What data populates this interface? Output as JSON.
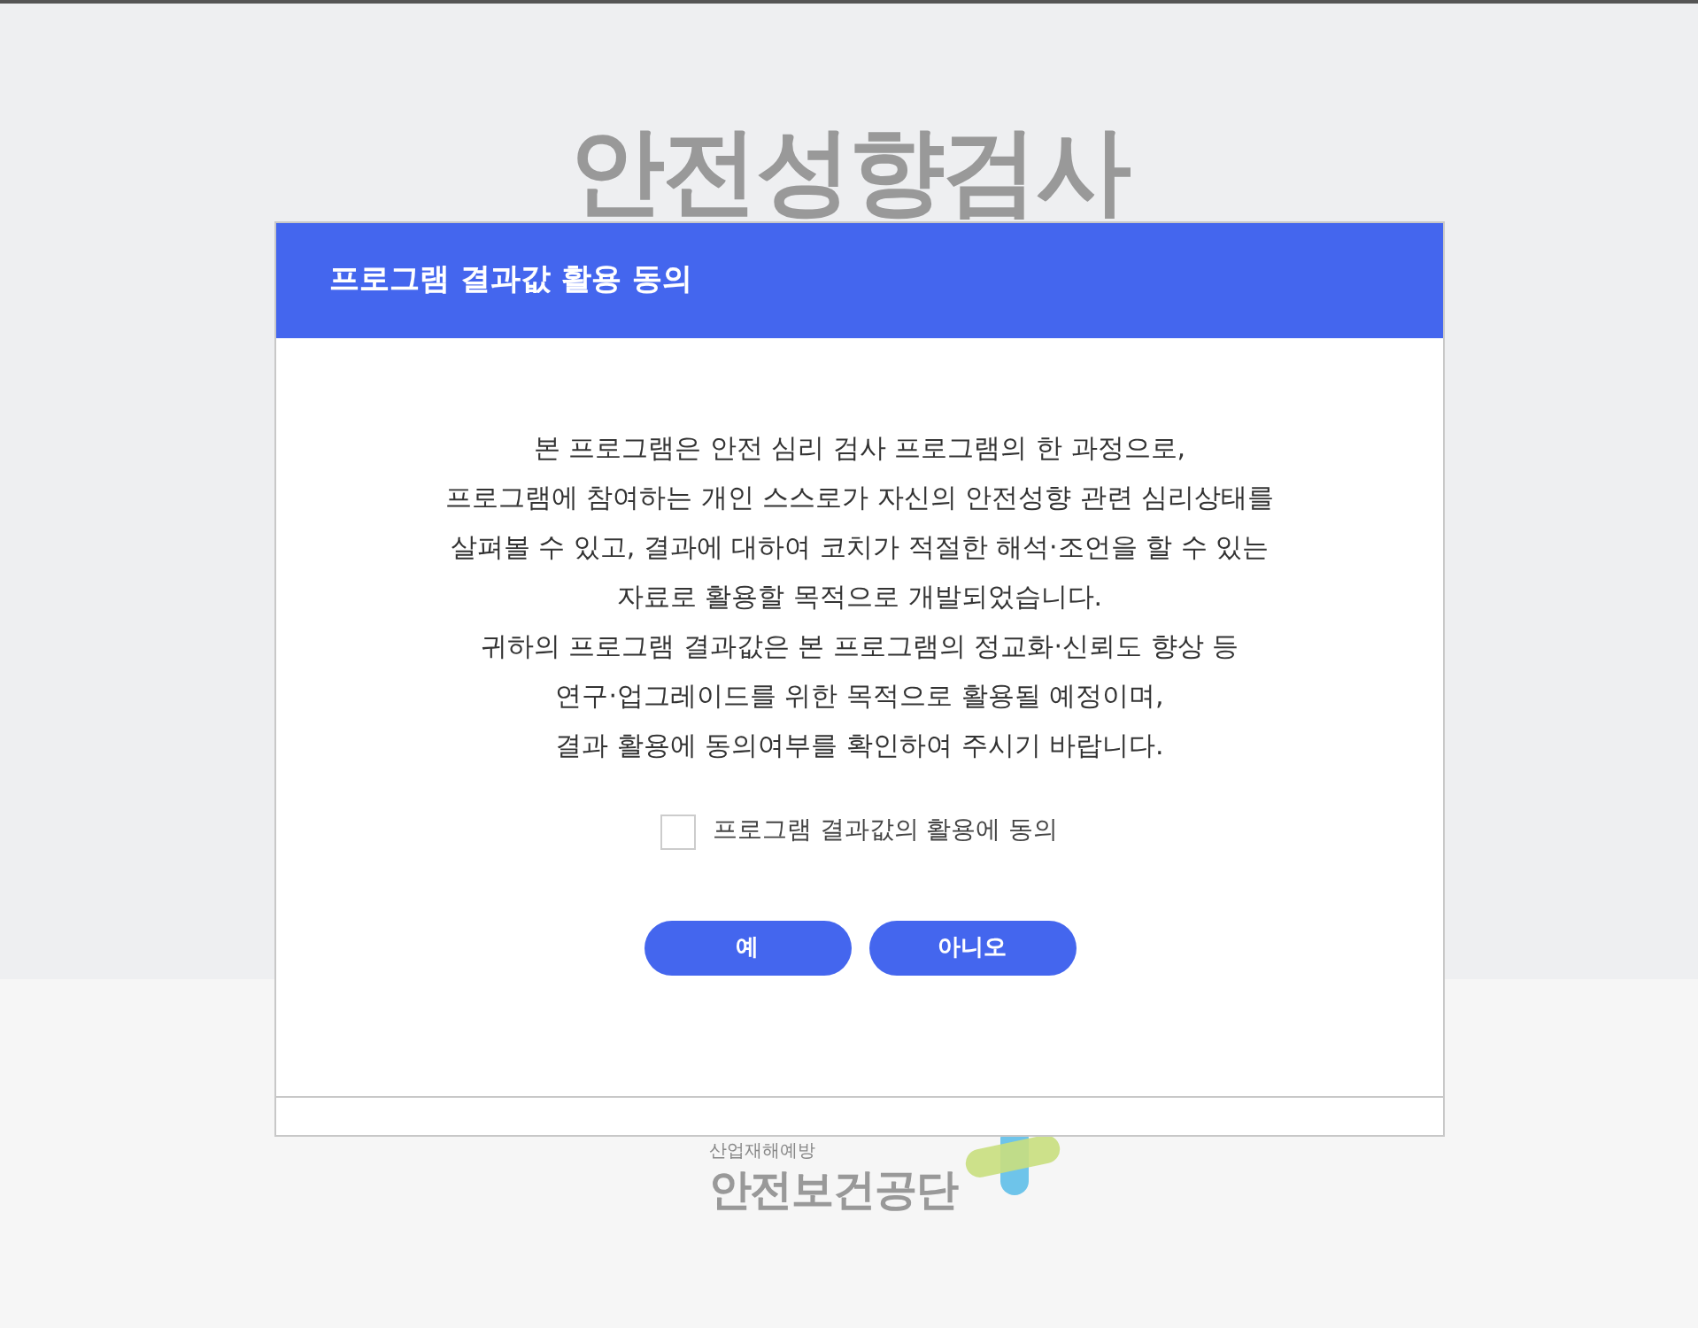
{
  "page_title": "안전성향검사",
  "dialog": {
    "title": "프로그램 결과값 활용 동의",
    "paragraph": [
      "본 프로그램은 안전 심리 검사 프로그램의 한 과정으로,",
      "프로그램에 참여하는 개인 스스로가 자신의 안전성향 관련 심리상태를",
      "살펴볼 수 있고, 결과에 대하여 코치가 적절한 해석·조언을 할 수 있는",
      "자료로 활용할 목적으로 개발되었습니다.",
      "귀하의 프로그램 결과값은 본 프로그램의 정교화·신뢰도 향상 등",
      "연구·업그레이드를 위한 목적으로 활용될 예정이며,",
      "결과 활용에 동의여부를 확인하여 주시기 바랍니다."
    ],
    "consent": {
      "label": "프로그램 결과값의 활용에 동의",
      "checked": false
    },
    "buttons": [
      "예",
      "아니오"
    ]
  },
  "logo": {
    "tagline": "산업재해예방",
    "name": "안전보건공단"
  }
}
